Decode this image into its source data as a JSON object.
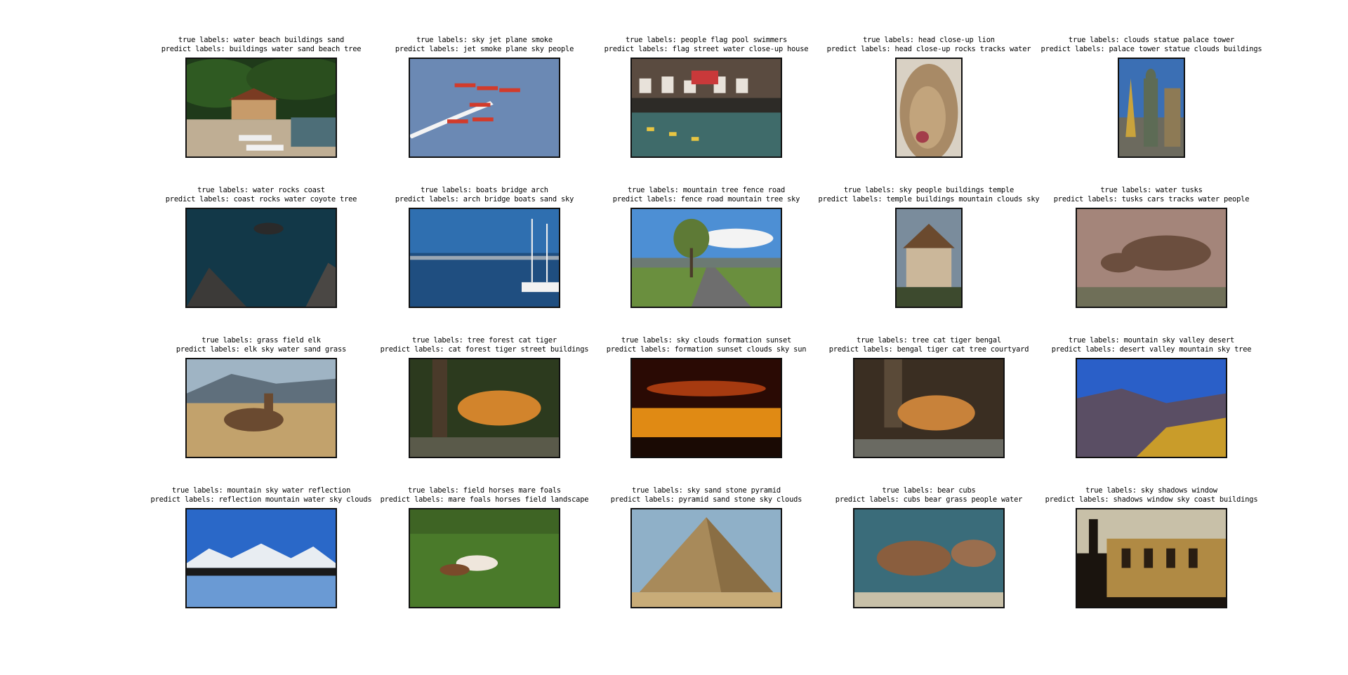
{
  "panels": [
    {
      "true_label": "true labels: water beach buildings sand",
      "predict_label": "predict labels: buildings water sand beach tree",
      "icon": "beach-scene-photo"
    },
    {
      "true_label": "true labels: sky jet plane smoke",
      "predict_label": "predict labels: jet smoke plane sky people",
      "icon": "jets-in-sky-photo"
    },
    {
      "true_label": "true labels: people flag pool swimmers",
      "predict_label": "predict labels: flag street water close-up house",
      "icon": "pool-swimmers-photo"
    },
    {
      "true_label": "true labels: head close-up lion",
      "predict_label": "predict labels: head close-up rocks tracks water",
      "icon": "lion-head-photo"
    },
    {
      "true_label": "true labels: clouds statue palace tower",
      "predict_label": "predict labels: palace tower statue clouds buildings",
      "icon": "palace-statue-photo"
    },
    {
      "true_label": "true labels: water rocks coast",
      "predict_label": "predict labels: coast rocks water coyote tree",
      "icon": "rocky-coast-photo"
    },
    {
      "true_label": "true labels: boats bridge arch",
      "predict_label": "predict labels: arch bridge boats sand sky",
      "icon": "boats-bridge-photo"
    },
    {
      "true_label": "true labels: mountain tree fence road",
      "predict_label": "predict labels: fence road mountain tree sky",
      "icon": "country-road-photo"
    },
    {
      "true_label": "true labels: sky people buildings temple",
      "predict_label": "predict labels: temple buildings mountain clouds sky",
      "icon": "temple-photo"
    },
    {
      "true_label": "true labels: water tusks",
      "predict_label": "predict labels: tusks cars tracks water people",
      "icon": "warthog-photo"
    },
    {
      "true_label": "true labels: grass field elk",
      "predict_label": "predict labels: elk sky water sand grass",
      "icon": "elk-field-photo"
    },
    {
      "true_label": "true labels: tree forest cat tiger",
      "predict_label": "predict labels: cat forest tiger street buildings",
      "icon": "tiger-forest-photo"
    },
    {
      "true_label": "true labels: sky clouds formation sunset",
      "predict_label": "predict labels: formation sunset clouds sky sun",
      "icon": "sunset-clouds-photo"
    },
    {
      "true_label": "true labels: tree cat tiger bengal",
      "predict_label": "predict labels: bengal tiger cat tree courtyard",
      "icon": "bengal-tiger-photo"
    },
    {
      "true_label": "true labels: mountain sky valley desert",
      "predict_label": "predict labels: desert valley mountain sky tree",
      "icon": "desert-valley-photo"
    },
    {
      "true_label": "true labels: mountain sky water reflection",
      "predict_label": "predict labels: reflection mountain water sky clouds",
      "icon": "mountain-reflection-photo"
    },
    {
      "true_label": "true labels: field horses mare foals",
      "predict_label": "predict labels: mare foals horses field landscape",
      "icon": "horses-field-photo"
    },
    {
      "true_label": "true labels: sky sand stone pyramid",
      "predict_label": "predict labels: pyramid sand stone sky clouds",
      "icon": "pyramid-photo"
    },
    {
      "true_label": "true labels: bear cubs",
      "predict_label": "predict labels: cubs bear grass people water",
      "icon": "bear-cubs-photo"
    },
    {
      "true_label": "true labels: sky shadows window",
      "predict_label": "predict labels: shadows window sky coast buildings",
      "icon": "building-shadows-photo"
    }
  ]
}
